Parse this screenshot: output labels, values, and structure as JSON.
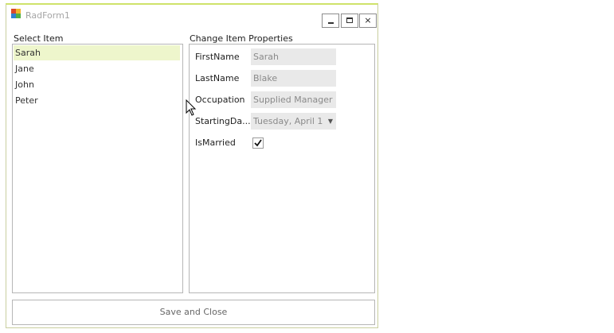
{
  "window": {
    "title": "RadForm1",
    "close_glyph": "×"
  },
  "left_group": {
    "label": "Select Item",
    "items": [
      "Sarah",
      "Jane",
      "John",
      "Peter"
    ]
  },
  "right_group": {
    "label": "Change Item Properties",
    "first_name_label": "FirstName",
    "first_name_value": "Sarah",
    "last_name_label": "LastName",
    "last_name_value": "Blake",
    "occupation_label": "Occupation",
    "occupation_value": "Supplied Manager",
    "starting_date_label": "StartingDa...",
    "starting_date_value": "Tuesday, April 1",
    "is_married_label": "IsMarried",
    "is_married_checked": true
  },
  "footer": {
    "save_close_label": "Save and  Close"
  },
  "icons": {
    "app": "app-icon",
    "minimize": "minimize-icon",
    "maximize": "maximize-icon",
    "close": "close-icon",
    "dropdown": "chevron-down-icon",
    "check": "checkmark-icon",
    "cursor": "mouse-cursor-icon"
  },
  "colors": {
    "selection": "#eef6cc",
    "window_accent": "#cfe26a",
    "field_bg": "#e9e9e9"
  }
}
